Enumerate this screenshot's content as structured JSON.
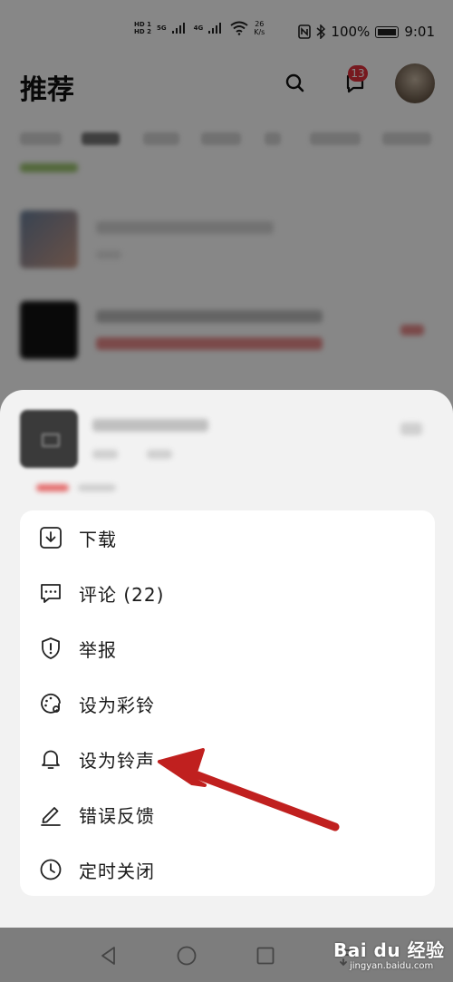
{
  "status_bar": {
    "hd1": "HD 1",
    "hd2": "HD 2",
    "net1": "5G",
    "net2": "4G",
    "speed_value": "26",
    "speed_unit": "K/s",
    "battery": "100%",
    "time": "9:01"
  },
  "header": {
    "title": "推荐",
    "badge_count": "13"
  },
  "menu": {
    "items": [
      {
        "label": "下载",
        "icon": "download-icon"
      },
      {
        "label": "评论 (22)",
        "icon": "comment-icon"
      },
      {
        "label": "举报",
        "icon": "report-shield-icon"
      },
      {
        "label": "设为彩铃",
        "icon": "color-ringtone-icon"
      },
      {
        "label": "设为铃声",
        "icon": "bell-icon"
      },
      {
        "label": "错误反馈",
        "icon": "edit-pencil-icon"
      },
      {
        "label": "定时关闭",
        "icon": "clock-icon"
      }
    ]
  },
  "colors": {
    "accent_red": "#e0303b",
    "annotation_arrow": "#c0201f",
    "sheet_bg": "#f2f2f2",
    "card_bg": "#ffffff"
  },
  "watermark": {
    "brand": "Bai du 经验",
    "url": "jingyan.baidu.com"
  }
}
